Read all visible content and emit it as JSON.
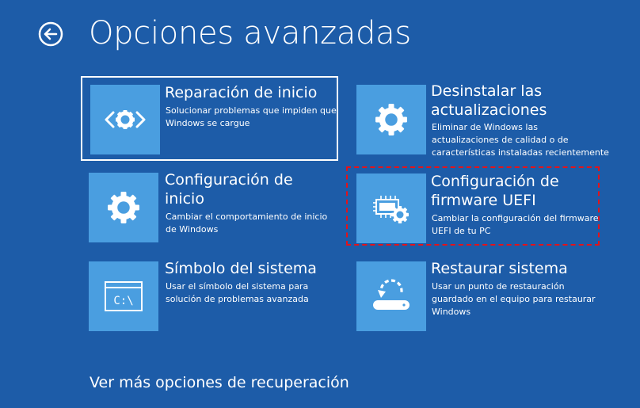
{
  "page": {
    "title": "Opciones avanzadas",
    "back_icon": "back-arrow-circle-icon",
    "more_link": "Ver más opciones de recuperación"
  },
  "colors": {
    "background": "#1d5ca8",
    "tile": "#4a9ee0",
    "text": "#ffffff",
    "selection_border": "#ffffff",
    "highlight_border": "#e3131a"
  },
  "options": [
    {
      "icon": "startup-repair-icon",
      "title_lines": [
        "Reparación de inicio"
      ],
      "desc_lines": [
        "Solucionar problemas que impiden que",
        "Windows se cargue"
      ],
      "state": "selected"
    },
    {
      "icon": "gear-icon",
      "title_lines": [
        "Desinstalar las",
        "actualizaciones"
      ],
      "desc_lines": [
        "Eliminar de Windows las",
        "actualizaciones de calidad o de",
        "características instaladas recientemente"
      ],
      "state": "normal"
    },
    {
      "icon": "gear-icon",
      "title_lines": [
        "Configuración de",
        "inicio"
      ],
      "desc_lines": [
        "Cambiar el comportamiento de inicio",
        "de Windows"
      ],
      "state": "normal"
    },
    {
      "icon": "firmware-chip-gear-icon",
      "title_lines": [
        "Configuración de",
        "firmware UEFI"
      ],
      "desc_lines": [
        "Cambiar la configuración del firmware",
        "UEFI de tu PC"
      ],
      "state": "highlighted"
    },
    {
      "icon": "command-prompt-icon",
      "title_lines": [
        "Símbolo del sistema"
      ],
      "desc_lines": [
        "Usar el símbolo del sistema para",
        "solución de problemas avanzada"
      ],
      "state": "normal"
    },
    {
      "icon": "system-restore-icon",
      "title_lines": [
        "Restaurar sistema"
      ],
      "desc_lines": [
        "Usar un punto de restauración",
        "guardado en el equipo para restaurar",
        "Windows"
      ],
      "state": "normal"
    }
  ],
  "command_prompt_icon_text": "C:\\"
}
